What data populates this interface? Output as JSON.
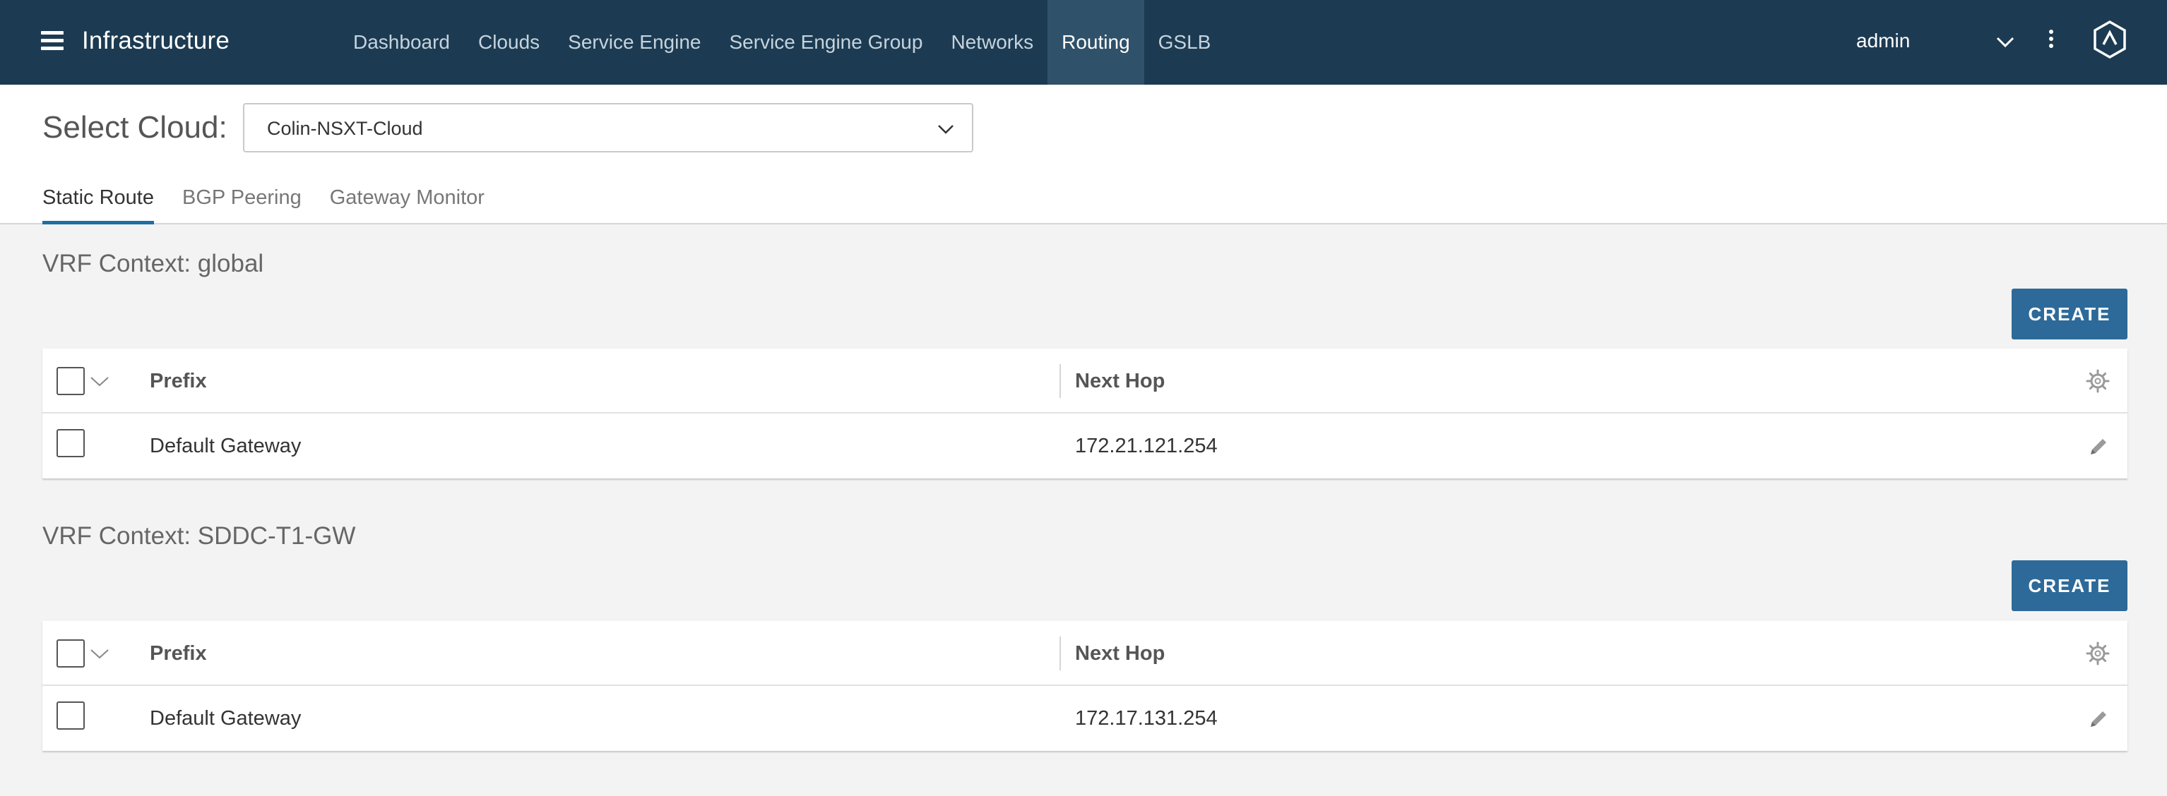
{
  "app": {
    "title": "Infrastructure"
  },
  "nav": {
    "items": [
      {
        "label": "Dashboard",
        "active": false
      },
      {
        "label": "Clouds",
        "active": false
      },
      {
        "label": "Service Engine",
        "active": false
      },
      {
        "label": "Service Engine Group",
        "active": false
      },
      {
        "label": "Networks",
        "active": false
      },
      {
        "label": "Routing",
        "active": true
      },
      {
        "label": "GSLB",
        "active": false
      }
    ],
    "user": "admin"
  },
  "cloud_select": {
    "label": "Select Cloud:",
    "value": "Colin-NSXT-Cloud"
  },
  "tabs": [
    {
      "label": "Static Route",
      "active": true
    },
    {
      "label": "BGP Peering",
      "active": false
    },
    {
      "label": "Gateway Monitor",
      "active": false
    }
  ],
  "sections": [
    {
      "title": "VRF Context: global",
      "create_label": "CREATE",
      "columns": [
        "Prefix",
        "Next Hop"
      ],
      "rows": [
        {
          "prefix": "Default Gateway",
          "next_hop": "172.21.121.254"
        }
      ]
    },
    {
      "title": "VRF Context: SDDC-T1-GW",
      "create_label": "CREATE",
      "columns": [
        "Prefix",
        "Next Hop"
      ],
      "rows": [
        {
          "prefix": "Default Gateway",
          "next_hop": "172.17.131.254"
        }
      ]
    }
  ],
  "colors": {
    "nav_bg": "#1c3b52",
    "nav_active": "#2f5169",
    "accent": "#2d6a99",
    "tab_underline": "#1d6fa3"
  },
  "icons": [
    "menu-icon",
    "chevron-down-icon",
    "kebab-menu-icon",
    "avi-logo-icon",
    "gear-icon",
    "pencil-icon"
  ]
}
